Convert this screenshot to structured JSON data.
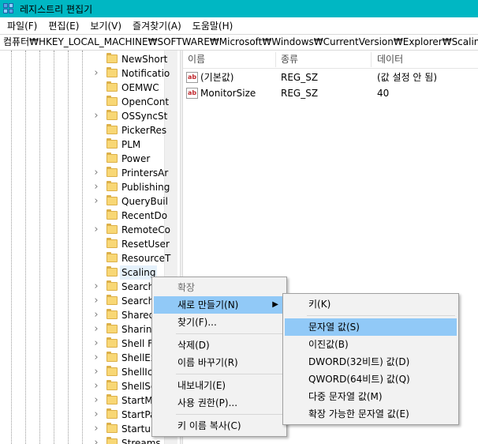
{
  "window": {
    "title": "레지스트리 편집기"
  },
  "menubar": [
    "파일(F)",
    "편집(E)",
    "보기(V)",
    "즐겨찾기(A)",
    "도움말(H)"
  ],
  "address": "컴퓨터₩HKEY_LOCAL_MACHINE₩SOFTWARE₩Microsoft₩Windows₩CurrentVersion₩Explorer₩Scaling",
  "tree": {
    "items": [
      {
        "label": "NewShort",
        "expandable": false
      },
      {
        "label": "Notificatio",
        "expandable": true
      },
      {
        "label": "OEMWC",
        "expandable": false
      },
      {
        "label": "OpenCont",
        "expandable": false
      },
      {
        "label": "OSSyncSt",
        "expandable": true
      },
      {
        "label": "PickerRes",
        "expandable": false
      },
      {
        "label": "PLM",
        "expandable": false
      },
      {
        "label": "Power",
        "expandable": false
      },
      {
        "label": "PrintersAr",
        "expandable": true
      },
      {
        "label": "Publishing",
        "expandable": true
      },
      {
        "label": "QueryBuil",
        "expandable": true
      },
      {
        "label": "RecentDo",
        "expandable": false
      },
      {
        "label": "RemoteCo",
        "expandable": true
      },
      {
        "label": "ResetUser",
        "expandable": false
      },
      {
        "label": "ResourceT",
        "expandable": false
      },
      {
        "label": "Scaling",
        "expandable": false,
        "selected": true
      },
      {
        "label": "Search",
        "expandable": true
      },
      {
        "label": "Search",
        "expandable": true
      },
      {
        "label": "Shared",
        "expandable": true
      },
      {
        "label": "Sharing",
        "expandable": true
      },
      {
        "label": "Shell F",
        "expandable": true
      },
      {
        "label": "ShellEx",
        "expandable": true
      },
      {
        "label": "ShellIc",
        "expandable": true
      },
      {
        "label": "ShellSe",
        "expandable": true
      },
      {
        "label": "StartM",
        "expandable": true
      },
      {
        "label": "StartPa",
        "expandable": true
      },
      {
        "label": "Startup",
        "expandable": true
      },
      {
        "label": "Streams",
        "expandable": true
      }
    ]
  },
  "list": {
    "headers": {
      "name": "이름",
      "type": "종류",
      "data": "데이터"
    },
    "rows": [
      {
        "name": "(기본값)",
        "type": "REG_SZ",
        "data": "(값 설정 안 됨)"
      },
      {
        "name": "MonitorSize",
        "type": "REG_SZ",
        "data": "40"
      }
    ]
  },
  "context_menu": {
    "items": [
      {
        "label": "확장",
        "disabled": true
      },
      {
        "label": "새로 만들기(N)",
        "submenu": true,
        "highlighted": true
      },
      {
        "label": "찾기(F)..."
      },
      {
        "sep": true
      },
      {
        "label": "삭제(D)"
      },
      {
        "label": "이름 바꾸기(R)"
      },
      {
        "sep": true
      },
      {
        "label": "내보내기(E)"
      },
      {
        "label": "사용 권한(P)..."
      },
      {
        "sep": true
      },
      {
        "label": "키 이름 복사(C)"
      }
    ]
  },
  "submenu": {
    "items": [
      {
        "label": "키(K)"
      },
      {
        "sep": true
      },
      {
        "label": "문자열 값(S)",
        "highlighted": true
      },
      {
        "label": "이진값(B)"
      },
      {
        "label": "DWORD(32비트) 값(D)"
      },
      {
        "label": "QWORD(64비트) 값(Q)"
      },
      {
        "label": "다중 문자열 값(M)"
      },
      {
        "label": "확장 가능한 문자열 값(E)"
      }
    ]
  },
  "icons": {
    "value_icon": "ab",
    "chevron": "›",
    "submenu_arrow": "▶"
  },
  "colors": {
    "titlebar": "#00b7c3",
    "menu_highlight": "#91c9f7",
    "folder": "#f8d775"
  }
}
